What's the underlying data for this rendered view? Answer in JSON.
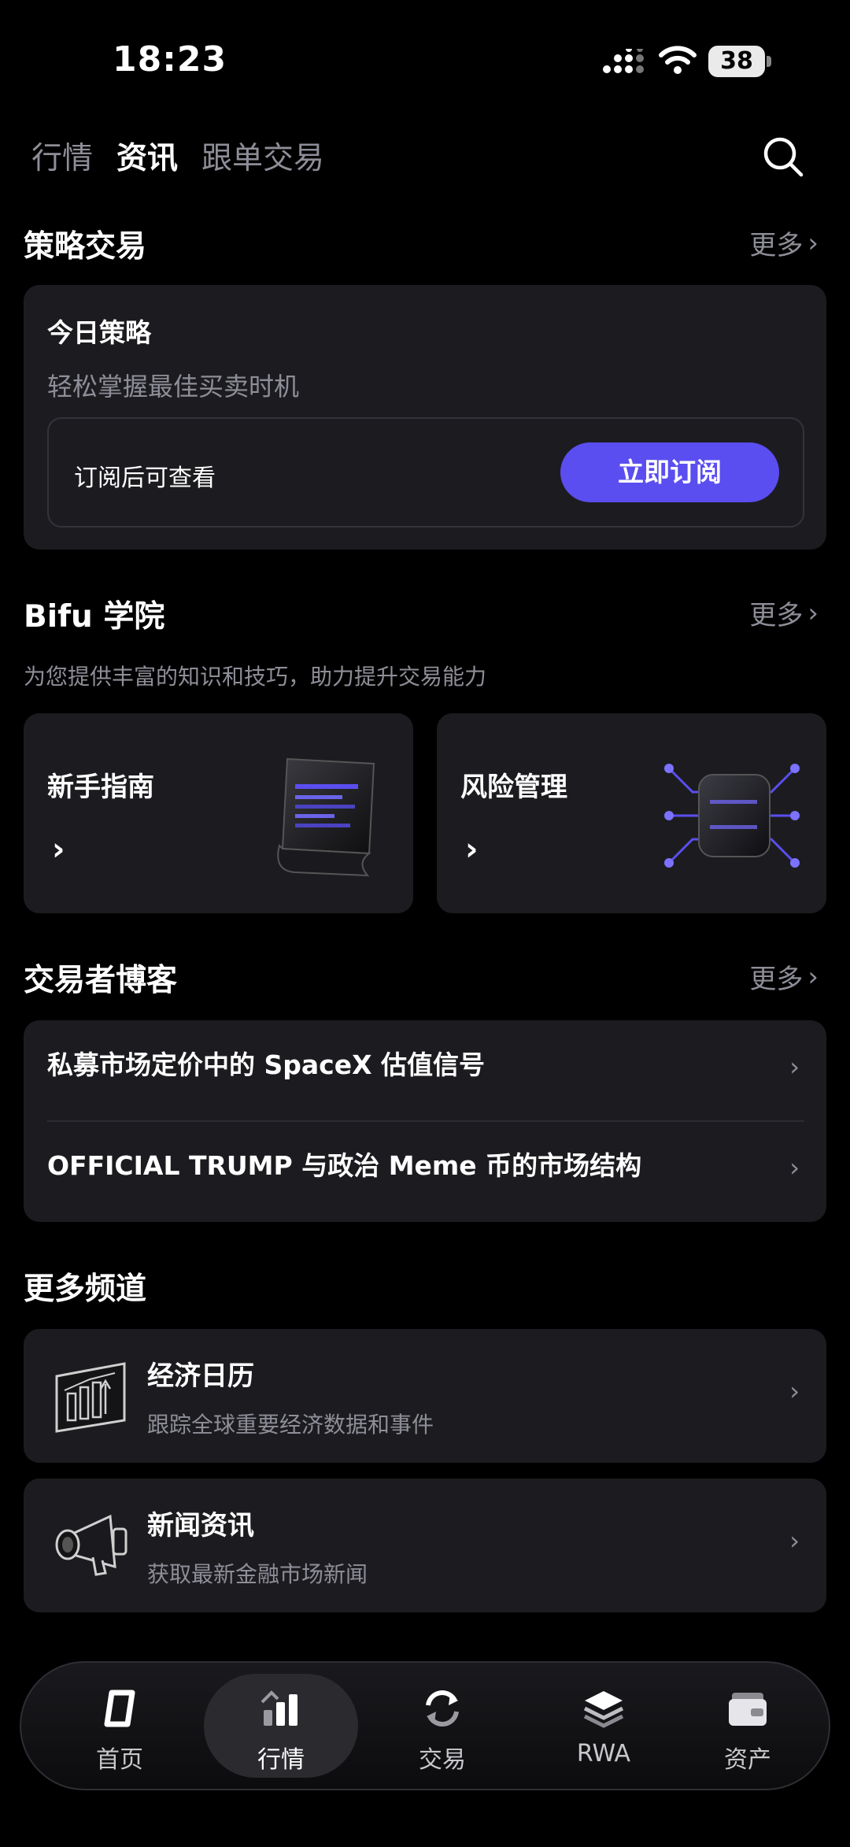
{
  "status_bar": {
    "time": "18:23",
    "battery": "38"
  },
  "top_tabs": [
    {
      "label": "行情",
      "active": false
    },
    {
      "label": "资讯",
      "active": true
    },
    {
      "label": "跟单交易",
      "active": false
    }
  ],
  "strategy": {
    "section_title": "策略交易",
    "more": "更多",
    "card_title": "今日策略",
    "card_sub": "轻松掌握最佳买卖时机",
    "hint": "订阅后可查看",
    "button": "立即订阅"
  },
  "academy": {
    "section_title": "Bifu 学院",
    "more": "更多",
    "desc": "为您提供丰富的知识和技巧，助力提升交易能力",
    "cards": [
      {
        "label": "新手指南",
        "icon": "scroll-icon"
      },
      {
        "label": "风险管理",
        "icon": "chip-icon"
      }
    ]
  },
  "blog": {
    "section_title": "交易者博客",
    "more": "更多",
    "items": [
      {
        "title": "私募市场定价中的 SpaceX 估值信号"
      },
      {
        "title": "OFFICIAL TRUMP 与政治 Meme 币的市场结构"
      }
    ]
  },
  "channels": {
    "section_title": "更多频道",
    "items": [
      {
        "title": "经济日历",
        "sub": "跟踪全球重要经济数据和事件",
        "icon": "chart-board-icon"
      },
      {
        "title": "新闻资讯",
        "sub": "获取最新金融市场新闻",
        "icon": "megaphone-icon"
      }
    ]
  },
  "bottom_nav": [
    {
      "label": "首页",
      "icon": "home-icon",
      "active": false
    },
    {
      "label": "行情",
      "icon": "market-icon",
      "active": true
    },
    {
      "label": "交易",
      "icon": "trade-icon",
      "active": false
    },
    {
      "label": "RWA",
      "icon": "rwa-icon",
      "active": false
    },
    {
      "label": "资产",
      "icon": "wallet-icon",
      "active": false
    }
  ],
  "colors": {
    "accent": "#5a4ef0",
    "card": "#1c1c20",
    "muted": "#8e8e98"
  }
}
